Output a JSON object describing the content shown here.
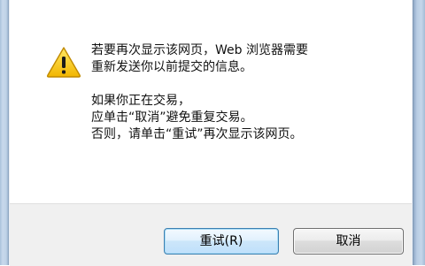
{
  "dialog": {
    "icon": "warning-icon",
    "message_lines_1": [
      "若要再次显示该网页，Web 浏览器需要",
      "重新发送你以前提交的信息。"
    ],
    "message_lines_2": [
      "如果你正在交易，",
      "应单击“取消”避免重复交易。",
      "否则，请单击“重试”再次显示该网页。"
    ],
    "buttons": {
      "retry_label": "重试(R)",
      "cancel_label": "取消"
    }
  },
  "colors": {
    "warning_yellow": "#f5c400",
    "primary_button_border": "#3c7fb1",
    "bottom_bar": "#f0f0f0"
  }
}
